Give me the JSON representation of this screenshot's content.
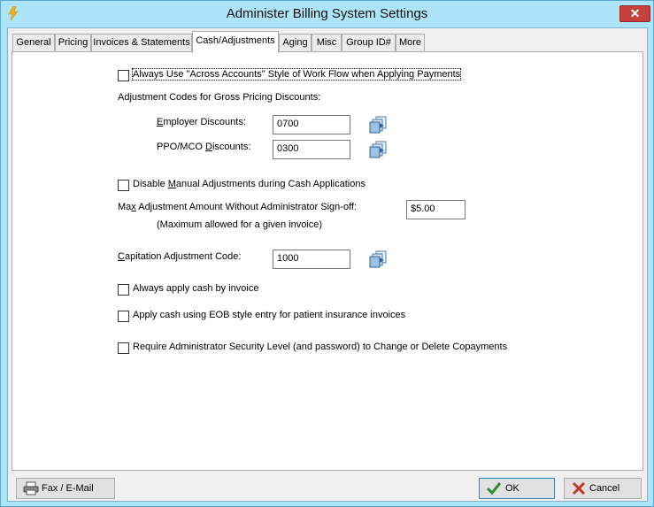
{
  "window": {
    "title": "Administer Billing System Settings",
    "close_label": "✕"
  },
  "tabs": [
    {
      "label": "General"
    },
    {
      "label": "Pricing"
    },
    {
      "label": "Invoices & Statements"
    },
    {
      "label": "Cash/Adjustments"
    },
    {
      "label": "Aging"
    },
    {
      "label": "Misc"
    },
    {
      "label": "Group ID#"
    },
    {
      "label": "More"
    }
  ],
  "active_tab": "Cash/Adjustments",
  "cash_adjustments": {
    "across_accounts": {
      "label": "Always Use \"Across Accounts\" Style of Work Flow when Applying Payments",
      "checked": false
    },
    "gross_pricing_heading": "Adjustment Codes for Gross Pricing Discounts:",
    "employer_discounts": {
      "label_pre": "",
      "label_key": "E",
      "label_post": "mployer Discounts:",
      "value": "0700"
    },
    "ppo_discounts": {
      "label_pre": "PPO/MCO ",
      "label_key": "D",
      "label_post": "iscounts:",
      "value": "0300"
    },
    "disable_manual": {
      "label_pre": "Disable ",
      "label_key": "M",
      "label_post": "anual Adjustments during Cash Applications",
      "checked": false
    },
    "max_adjustment": {
      "label_pre": "Ma",
      "label_key": "x",
      "label_post": " Adjustment Amount Without Administrator Sign-off:",
      "value": "$5.00",
      "note": "(Maximum allowed for a given invoice)"
    },
    "capitation": {
      "label_pre": "",
      "label_key": "C",
      "label_post": "apitation Adjustment Code:",
      "value": "1000"
    },
    "apply_by_invoice": {
      "label": "Always apply cash by invoice",
      "checked": false
    },
    "eob_entry": {
      "label": "Apply cash using EOB style entry for patient insurance invoices",
      "checked": false
    },
    "require_admin": {
      "label": "Require Administrator Security Level (and password) to Change or Delete Copayments",
      "checked": false
    }
  },
  "footer": {
    "fax_label": "Fax / E-Mail",
    "ok_label": "OK",
    "cancel_label": "Cancel"
  },
  "colors": {
    "frame": "#aee4f7",
    "close_button": "#c7413c",
    "ok_check": "#2e8b2e",
    "cancel_x": "#c0392b"
  }
}
